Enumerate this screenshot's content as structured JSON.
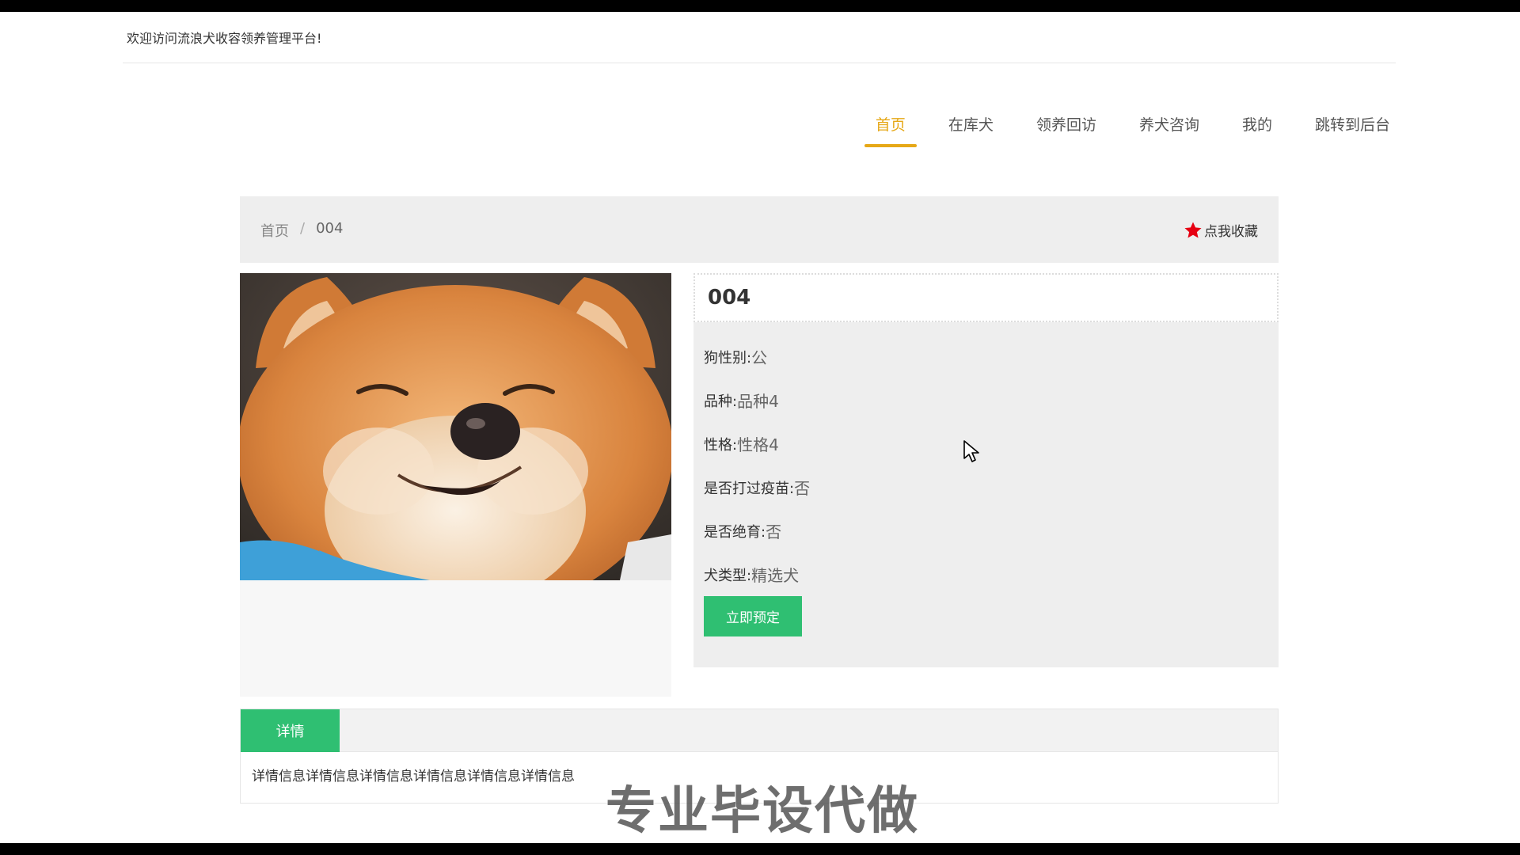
{
  "header": {
    "welcome": "欢迎访问流浪犬收容领养管理平台!"
  },
  "nav": {
    "items": [
      {
        "label": "首页",
        "active": true
      },
      {
        "label": "在库犬"
      },
      {
        "label": "领养回访"
      },
      {
        "label": "养犬咨询"
      },
      {
        "label": "我的"
      },
      {
        "label": "跳转到后台"
      }
    ]
  },
  "breadcrumb": {
    "home": "首页",
    "separator": "/",
    "current": "004"
  },
  "favorite": {
    "label": "点我收藏",
    "icon": "star-icon",
    "color": "#e60012"
  },
  "dog": {
    "title": "004",
    "fields": [
      {
        "key": "狗性别:",
        "value": "公"
      },
      {
        "key": "品种:",
        "value": "品种4"
      },
      {
        "key": "性格:",
        "value": "性格4"
      },
      {
        "key": "是否打过疫苗:",
        "value": "否"
      },
      {
        "key": "是否绝育:",
        "value": "否"
      },
      {
        "key": "犬类型:",
        "value": "精选犬"
      }
    ],
    "reserve_label": "立即预定"
  },
  "detail": {
    "tab_label": "详情",
    "text": "详情信息详情信息详情信息详情信息详情信息详情信息"
  },
  "overlay": {
    "watermark": "专业毕设代做"
  },
  "colors": {
    "accent": "#e6a817",
    "primary_green": "#2fbf72"
  }
}
